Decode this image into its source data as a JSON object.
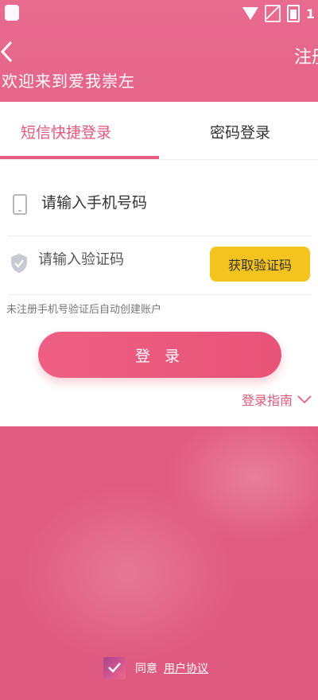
{
  "status_bar": {
    "time_partial": "1"
  },
  "header": {
    "back_icon": "chevron-left-icon",
    "register_label": "注册",
    "welcome": "欢迎来到爱我崇左"
  },
  "tabs": [
    {
      "label": "短信快捷登录",
      "active": true
    },
    {
      "label": "密码登录",
      "active": false
    }
  ],
  "form": {
    "phone": {
      "placeholder": "请输入手机号码",
      "value": "",
      "icon": "phone-icon"
    },
    "code": {
      "placeholder": "请输入验证码",
      "value": "",
      "icon": "shield-check-icon"
    },
    "get_code_label": "获取验证码",
    "hint": "未注册手机号验证后自动创建账户",
    "login_label": "登 录",
    "guide_label": "登录指南"
  },
  "footer": {
    "checkbox_checked": true,
    "agree_label": "同意",
    "agreement_link": "用户协议"
  },
  "colors": {
    "brand_pink": "#e85a80",
    "button_yellow": "#f5c31d",
    "tab_active": "#e2577b"
  }
}
